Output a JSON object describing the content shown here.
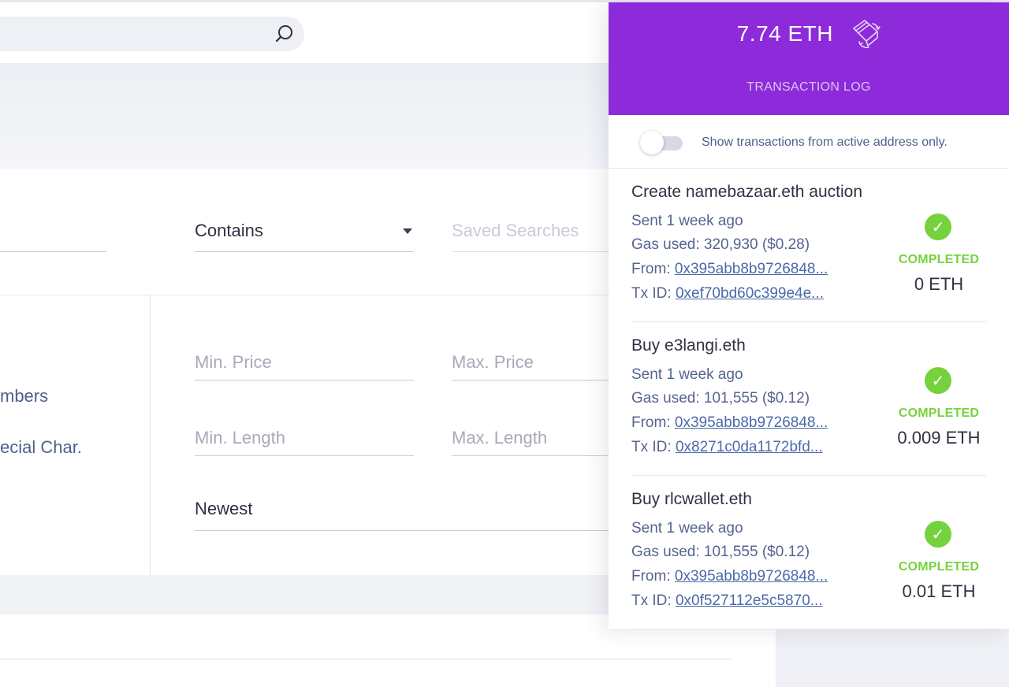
{
  "search": {
    "placeholder": ""
  },
  "filters": {
    "match_type": "Contains",
    "saved_searches": "Saved Searches",
    "min_price": "Min. Price",
    "max_price": "Max. Price",
    "min_length": "Min. Length",
    "max_length": "Max. Length",
    "sort": "Newest",
    "option_numbers": "mbers",
    "option_special": "ecial Char."
  },
  "transaction_panel": {
    "balance": "7.74 ETH",
    "title": "TRANSACTION LOG",
    "toggle_label": "Show transactions from active address only.",
    "toggle_on": false,
    "accent_color": "#8d2ad9",
    "status_color": "#76d23c",
    "transactions": [
      {
        "title": "Create namebazaar.eth auction",
        "sent": "Sent 1 week ago",
        "gas": "Gas used: 320,930 ($0.28)",
        "from_label": "From:",
        "from": "0x395abb8b9726848...",
        "tx_label": "Tx ID:",
        "tx_id": "0xef70bd60c399e4e...",
        "status": "COMPLETED",
        "amount": "0 ETH"
      },
      {
        "title": "Buy e3langi.eth",
        "sent": "Sent 1 week ago",
        "gas": "Gas used: 101,555 ($0.12)",
        "from_label": "From:",
        "from": "0x395abb8b9726848...",
        "tx_label": "Tx ID:",
        "tx_id": "0x8271c0da1172bfd...",
        "status": "COMPLETED",
        "amount": "0.009 ETH"
      },
      {
        "title": "Buy rlcwallet.eth",
        "sent": "Sent 1 week ago",
        "gas": "Gas used: 101,555 ($0.12)",
        "from_label": "From:",
        "from": "0x395abb8b9726848...",
        "tx_label": "Tx ID:",
        "tx_id": "0x0f527112e5c5870...",
        "status": "COMPLETED",
        "amount": "0.01 ETH"
      }
    ]
  }
}
